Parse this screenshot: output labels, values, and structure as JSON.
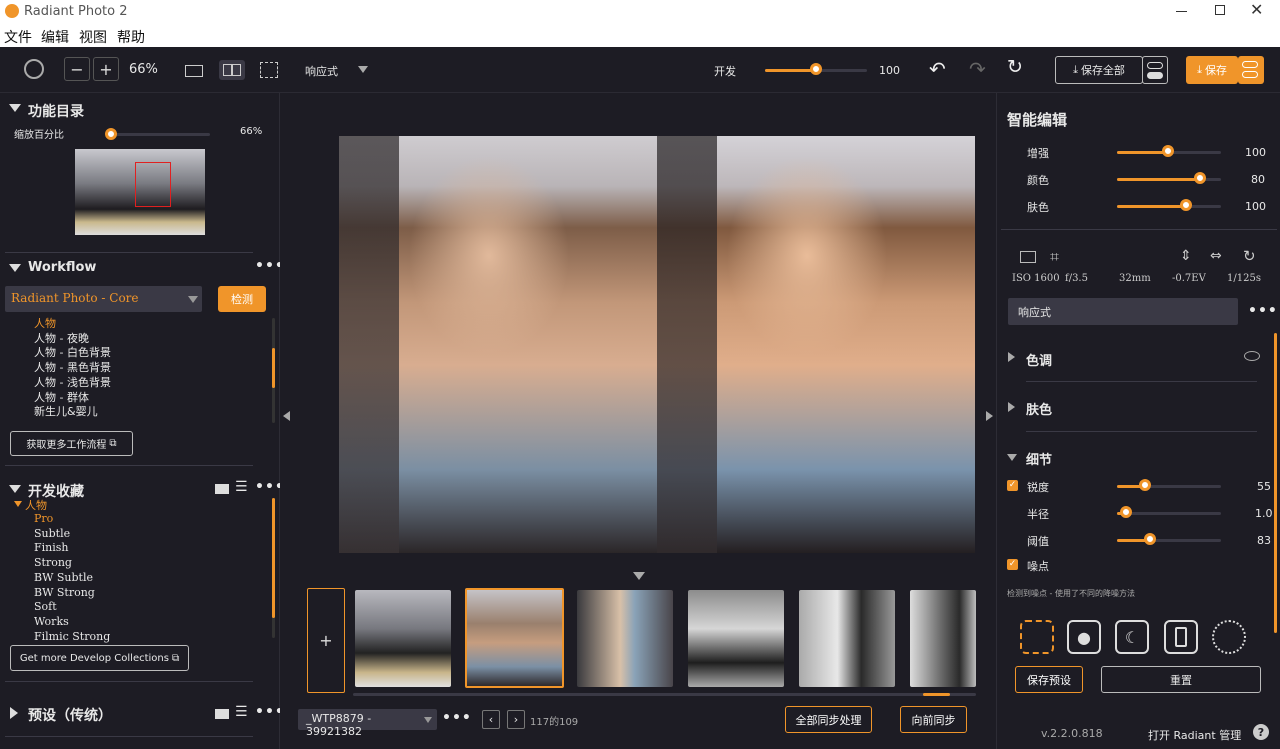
{
  "window": {
    "title": "Radiant Photo 2"
  },
  "menu": [
    "文件",
    "编辑",
    "视图",
    "帮助"
  ],
  "toolbar": {
    "zoom": "66%",
    "profile": "响应式",
    "develop_label": "开发",
    "develop_value": 100,
    "save_all": "保存全部",
    "save": "保存"
  },
  "left": {
    "catalog_title": "功能目录",
    "zoom_label": "缩放百分比",
    "zoom_value": "66%",
    "workflow_title": "Workflow",
    "workflow_select": "Radiant Photo - Core",
    "detect": "检测",
    "workflow_items": [
      "人物",
      "人物 - 夜晚",
      "人物 - 白色背景",
      "人物 - 黑色背景",
      "人物 - 浅色背景",
      "人物 - 群体",
      "新生儿&婴儿"
    ],
    "get_more_workflows": "获取更多工作流程",
    "collections_title": "开发收藏",
    "collection_group": "人物",
    "collection_items": [
      "Pro",
      "Subtle",
      "Finish",
      "Strong",
      "BW Subtle",
      "BW Strong",
      "Soft",
      "Works",
      "Filmic Strong"
    ],
    "get_more_collections": "Get more Develop Collections",
    "presets_title": "预设（传统）"
  },
  "center": {
    "file_name": "_WTP8879 - 39921382",
    "page_info": "117的109",
    "sync_all": "全部同步处理",
    "sync_forward": "向前同步",
    "add": "+"
  },
  "right": {
    "smart_title": "智能编辑",
    "smart_sliders": [
      {
        "label": "增强",
        "value": 100
      },
      {
        "label": "颜色",
        "value": 80
      },
      {
        "label": "肤色",
        "value": 100
      }
    ],
    "exif": [
      "ISO 1600",
      "f/3.5",
      "32mm",
      "-0.7EV",
      "1/125s"
    ],
    "preset_field": "响应式",
    "sections": [
      "色调",
      "肤色",
      "细节"
    ],
    "detail_sliders": [
      {
        "label": "锐度",
        "value": "55"
      },
      {
        "label": "半径",
        "value": "1.0"
      },
      {
        "label": "阈值",
        "value": "83"
      }
    ],
    "noise_label": "噪点",
    "noise_note": "检测到噪点 - 使用了不同的降噪方法",
    "save_preset": "保存预设",
    "reset": "重置",
    "version": "v.2.2.0.818",
    "open_manager": "打开 Radiant 管理"
  },
  "colors": {
    "accent": "#f0952a",
    "bg": "#1d1c24"
  }
}
